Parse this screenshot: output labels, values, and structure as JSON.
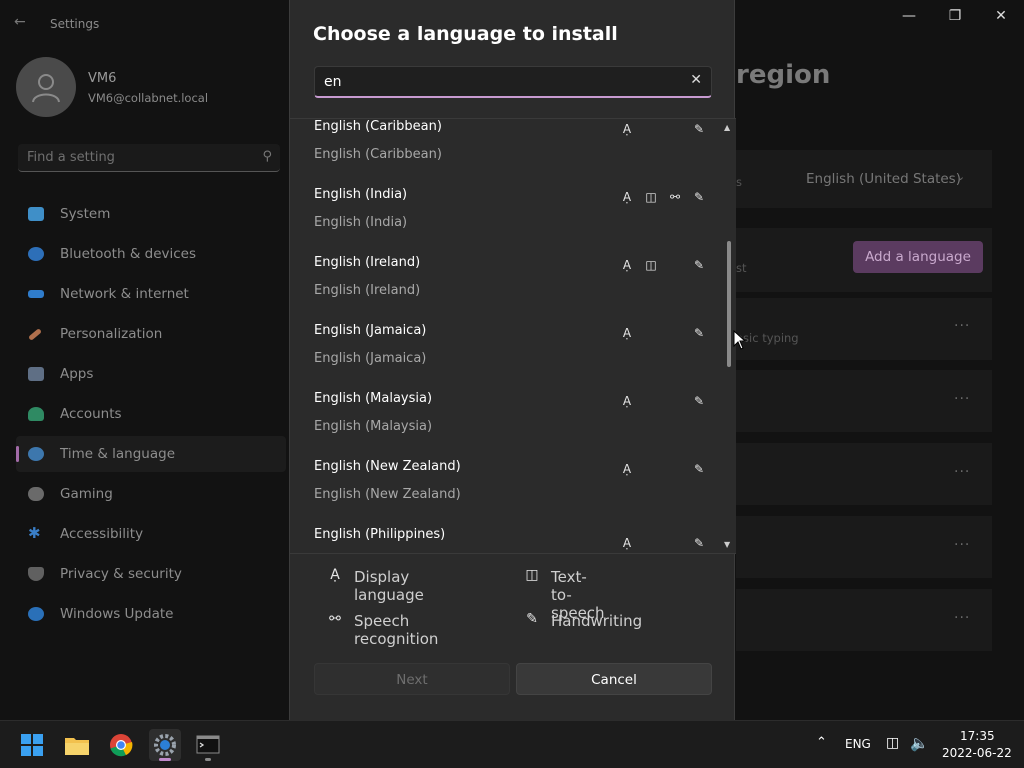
{
  "settings": {
    "app_title": "Settings",
    "user": {
      "name": "VM6",
      "email": "VM6@collabnet.local"
    },
    "search_placeholder": "Find a setting",
    "nav": [
      {
        "label": "System",
        "icon": "monitor-icon",
        "color": "#4aa3df"
      },
      {
        "label": "Bluetooth & devices",
        "icon": "bluetooth-icon",
        "color": "#2d7fd3"
      },
      {
        "label": "Network & internet",
        "icon": "wifi-icon",
        "color": "#3a8ee6"
      },
      {
        "label": "Personalization",
        "icon": "brush-icon",
        "color": "#c9825a"
      },
      {
        "label": "Apps",
        "icon": "apps-icon",
        "color": "#7a8ea8"
      },
      {
        "label": "Accounts",
        "icon": "person-icon",
        "color": "#3fae7a"
      },
      {
        "label": "Time & language",
        "icon": "globe-clock-icon",
        "color": "#4b8fd1"
      },
      {
        "label": "Gaming",
        "icon": "controller-icon",
        "color": "#8a8a8a"
      },
      {
        "label": "Accessibility",
        "icon": "accessibility-icon",
        "color": "#3a8ee6"
      },
      {
        "label": "Privacy & security",
        "icon": "shield-icon",
        "color": "#8a8a8a"
      },
      {
        "label": "Windows Update",
        "icon": "update-icon",
        "color": "#2f86d8"
      }
    ],
    "content": {
      "title_partial": "region",
      "preferred_language": "English (United States)",
      "add_language_label": "Add a language",
      "faint_text_1": "s",
      "faint_text_2": "st",
      "faint_text_3": "asic typing"
    }
  },
  "dialog": {
    "title": "Choose a language to install",
    "search_value": "en",
    "languages": [
      {
        "name": "English (Caribbean)",
        "native": "English (Caribbean)",
        "features": [
          "display-language",
          "handwriting"
        ]
      },
      {
        "name": "English (India)",
        "native": "English (India)",
        "features": [
          "display-language",
          "text-to-speech",
          "speech-recognition",
          "handwriting"
        ]
      },
      {
        "name": "English (Ireland)",
        "native": "English (Ireland)",
        "features": [
          "display-language",
          "text-to-speech",
          "handwriting"
        ]
      },
      {
        "name": "English (Jamaica)",
        "native": "English (Jamaica)",
        "features": [
          "display-language",
          "handwriting"
        ]
      },
      {
        "name": "English (Malaysia)",
        "native": "English (Malaysia)",
        "features": [
          "display-language",
          "handwriting"
        ]
      },
      {
        "name": "English (New Zealand)",
        "native": "English (New Zealand)",
        "features": [
          "display-language",
          "handwriting"
        ]
      },
      {
        "name": "English (Philippines)",
        "native": "",
        "features": [
          "display-language",
          "handwriting"
        ]
      }
    ],
    "legend": {
      "display_language": "Display language",
      "text_to_speech": "Text-to-speech",
      "speech_recognition": "Speech recognition",
      "handwriting": "Handwriting"
    },
    "next_label": "Next",
    "cancel_label": "Cancel"
  },
  "taskbar": {
    "apps": [
      "start-icon",
      "file-explorer-icon",
      "chrome-icon",
      "settings-icon",
      "terminal-icon"
    ],
    "tray_lang": "ENG",
    "time": "17:35",
    "date": "2022-06-22"
  }
}
